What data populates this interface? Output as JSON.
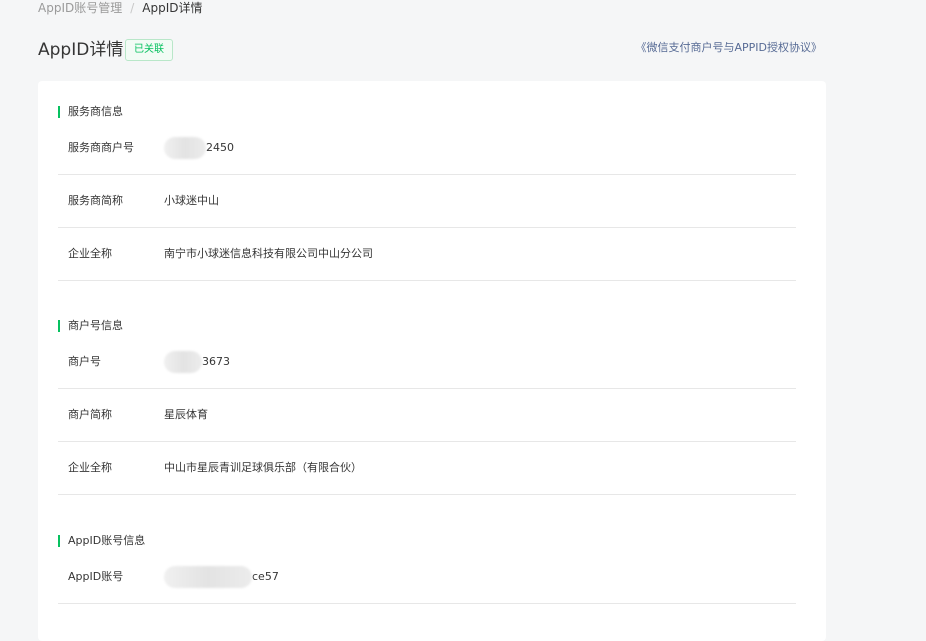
{
  "breadcrumb": {
    "parent": "AppID账号管理",
    "separator": "/",
    "current": "AppID详情"
  },
  "header": {
    "title": "AppID详情",
    "status_badge": "已关联",
    "agreement_link": "《微信支付商户号与APPID授权协议》"
  },
  "colors": {
    "accent": "#07c160",
    "link": "#576b95"
  },
  "sections": [
    {
      "title": "服务商信息",
      "rows": [
        {
          "label": "服务商商户号",
          "value": "2450",
          "masked": true
        },
        {
          "label": "服务商简称",
          "value": "小球迷中山"
        },
        {
          "label": "企业全称",
          "value": "南宁市小球迷信息科技有限公司中山分公司"
        }
      ]
    },
    {
      "title": "商户号信息",
      "rows": [
        {
          "label": "商户号",
          "value": "3673",
          "masked": true
        },
        {
          "label": "商户简称",
          "value": "星辰体育"
        },
        {
          "label": "企业全称",
          "value": "中山市星辰青训足球俱乐部（有限合伙）"
        }
      ]
    },
    {
      "title": "AppID账号信息",
      "rows": [
        {
          "label": "AppID账号",
          "value": "ce57",
          "masked": true
        }
      ]
    }
  ]
}
